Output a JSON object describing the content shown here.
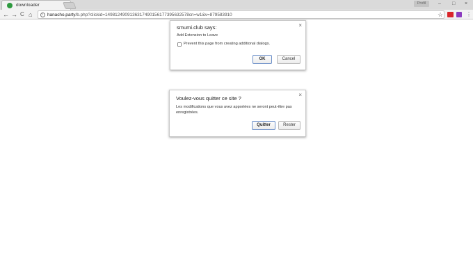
{
  "browser": {
    "tab": {
      "title": "downloader",
      "close": "×"
    },
    "profile_label": "Profil",
    "window_controls": {
      "minimize": "–",
      "maximize": "□",
      "close": "×"
    },
    "nav": {
      "back": "←",
      "forward": "→",
      "reload": "C",
      "home": "⌂"
    },
    "omnibox": {
      "host": "hanacho.party",
      "path": "/b.php?clickid=1498124909136317490156177395632578cn=w1&v=879583910"
    }
  },
  "dialog1": {
    "title": "smumi.club says:",
    "message": "Add Extension to Leave",
    "checkbox_label": "Prevent this page from creating additional dialogs.",
    "ok_label": "OK",
    "cancel_label": "Cancel",
    "close": "×"
  },
  "dialog2": {
    "title": "Voulez-vous quitter ce site ?",
    "message": "Les modifications que vous avez apportées ne seront peut-être pas enregistrées.",
    "leave_label": "Quitter",
    "stay_label": "Rester",
    "close": "×"
  },
  "colors": {
    "accent": "#6b8fc9",
    "tabbar": "#dadada",
    "favicon": "#2e9a3f",
    "ext_red": "#d9252a",
    "ext_purple": "#8b3bbf"
  }
}
